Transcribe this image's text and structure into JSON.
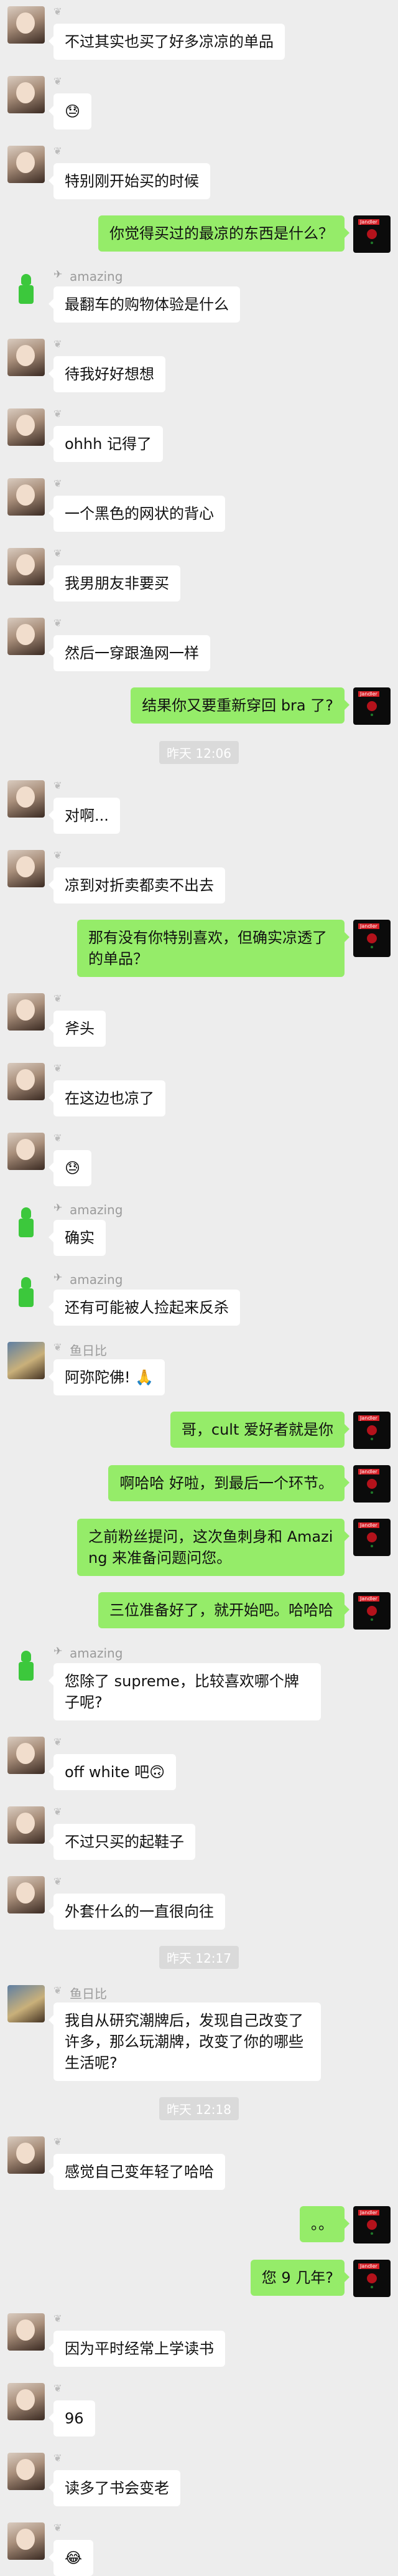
{
  "messages": [
    {
      "type": "msg",
      "side": "left",
      "avatar": "girl",
      "text": "不过其实也买了好多凉凉的单品"
    },
    {
      "type": "msg",
      "side": "left",
      "avatar": "girl",
      "text": "😓"
    },
    {
      "type": "msg",
      "side": "left",
      "avatar": "girl",
      "text": "特别刚开始买的时候"
    },
    {
      "type": "msg",
      "side": "right",
      "avatar": "rose",
      "text": "你觉得买过的最凉的东西是什么？"
    },
    {
      "type": "msg",
      "side": "left",
      "avatar": "green",
      "sender": "amazing",
      "text": "最翻车的购物体验是什么"
    },
    {
      "type": "msg",
      "side": "left",
      "avatar": "girl",
      "text": "待我好好想想"
    },
    {
      "type": "msg",
      "side": "left",
      "avatar": "girl",
      "text": "ohhh 记得了"
    },
    {
      "type": "msg",
      "side": "left",
      "avatar": "girl",
      "text": "一个黑色的网状的背心"
    },
    {
      "type": "msg",
      "side": "left",
      "avatar": "girl",
      "text": "我男朋友非要买"
    },
    {
      "type": "msg",
      "side": "left",
      "avatar": "girl",
      "text": "然后一穿跟渔网一样"
    },
    {
      "type": "msg",
      "side": "right",
      "avatar": "rose",
      "text": "结果你又要重新穿回 bra 了?"
    },
    {
      "type": "time",
      "text": "昨天 12:06"
    },
    {
      "type": "msg",
      "side": "left",
      "avatar": "girl",
      "text": "对啊..."
    },
    {
      "type": "msg",
      "side": "left",
      "avatar": "girl",
      "text": "凉到对折卖都卖不出去"
    },
    {
      "type": "msg",
      "side": "right",
      "avatar": "rose",
      "text": "那有没有你特别喜欢，但确实凉透了的单品？"
    },
    {
      "type": "msg",
      "side": "left",
      "avatar": "girl",
      "text": "斧头"
    },
    {
      "type": "msg",
      "side": "left",
      "avatar": "girl",
      "text": "在这边也凉了"
    },
    {
      "type": "msg",
      "side": "left",
      "avatar": "girl",
      "text": "😓"
    },
    {
      "type": "msg",
      "side": "left",
      "avatar": "green",
      "sender": "amazing",
      "text": "确实"
    },
    {
      "type": "msg",
      "side": "left",
      "avatar": "green",
      "sender": "amazing",
      "text": "还有可能被人捡起来反杀"
    },
    {
      "type": "msg",
      "side": "left",
      "avatar": "yuan",
      "sender": "鱼日比",
      "text": "阿弥陀佛! 🙏"
    },
    {
      "type": "msg",
      "side": "right",
      "avatar": "rose",
      "text": "哥，cult 爱好者就是你"
    },
    {
      "type": "msg",
      "side": "right",
      "avatar": "rose",
      "text": "啊哈哈 好啦，到最后一个环节。"
    },
    {
      "type": "msg",
      "side": "right",
      "avatar": "rose",
      "text": "之前粉丝提问，这次鱼刺身和 Amazing 来准备问题问您。"
    },
    {
      "type": "msg",
      "side": "right",
      "avatar": "rose",
      "text": "三位准备好了，就开始吧。哈哈哈"
    },
    {
      "type": "msg",
      "side": "left",
      "avatar": "green",
      "sender": "amazing",
      "text": "您除了 supreme，比较喜欢哪个牌子呢?"
    },
    {
      "type": "msg",
      "side": "left",
      "avatar": "girl",
      "text": "off white 吧🙃"
    },
    {
      "type": "msg",
      "side": "left",
      "avatar": "girl",
      "text": "不过只买的起鞋子"
    },
    {
      "type": "msg",
      "side": "left",
      "avatar": "girl",
      "text": "外套什么的一直很向往"
    },
    {
      "type": "time",
      "text": "昨天 12:17"
    },
    {
      "type": "msg",
      "side": "left",
      "avatar": "yuan",
      "sender": "鱼日比",
      "text": "我自从研究潮牌后，发现自己改变了许多，那么玩潮牌，改变了你的哪些生活呢?"
    },
    {
      "type": "time",
      "text": "昨天 12:18"
    },
    {
      "type": "msg",
      "side": "left",
      "avatar": "girl",
      "text": "感觉自己变年轻了哈哈"
    },
    {
      "type": "msg",
      "side": "right",
      "avatar": "rose",
      "text": "。。"
    },
    {
      "type": "msg",
      "side": "right",
      "avatar": "rose",
      "text": "您 9 几年?"
    },
    {
      "type": "msg",
      "side": "left",
      "avatar": "girl",
      "text": "因为平时经常上学读书"
    },
    {
      "type": "msg",
      "side": "left",
      "avatar": "girl",
      "text": "96"
    },
    {
      "type": "msg",
      "side": "left",
      "avatar": "girl",
      "text": "读多了书会变老"
    },
    {
      "type": "msg",
      "side": "left",
      "avatar": "girl",
      "text": "😂"
    }
  ]
}
